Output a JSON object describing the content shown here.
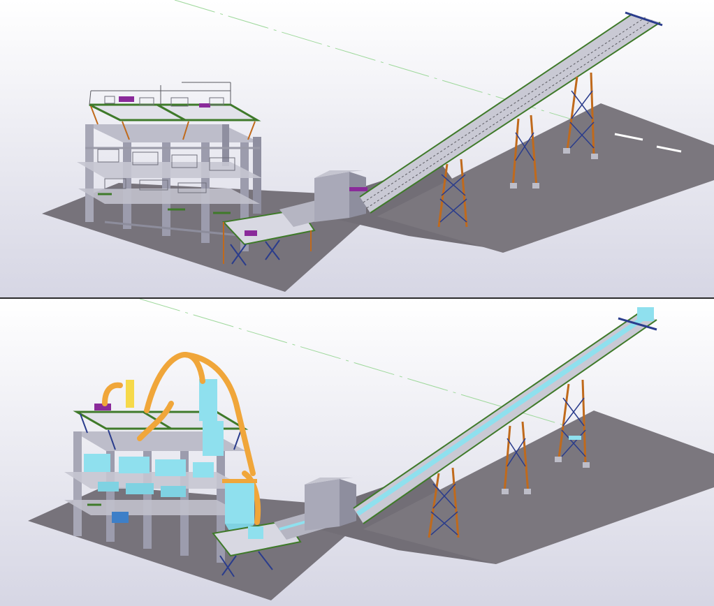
{
  "views": [
    {
      "id": "steel-structure-view",
      "layers": [
        "structure"
      ]
    },
    {
      "id": "full-plant-view",
      "layers": [
        "structure",
        "equipment",
        "ducting",
        "conveyor-belt"
      ]
    }
  ],
  "colors": {
    "background_top": "#ffffff",
    "background_bottom": "#d9d9e6",
    "ground": "#7b777e",
    "ground_dark": "#6d6971",
    "column": "#a7a7b6",
    "column_dark": "#8a8a9a",
    "beam_green": "#3f7a2a",
    "brace_orange": "#c06a1c",
    "brace_blue": "#2a3c8c",
    "handrail": "#58585f",
    "equipment_cyan": "#8fe0ee",
    "ducting_orange": "#f0a63a",
    "accent_purple": "#8a2a9a",
    "gridline_green": "#9ed89b"
  }
}
